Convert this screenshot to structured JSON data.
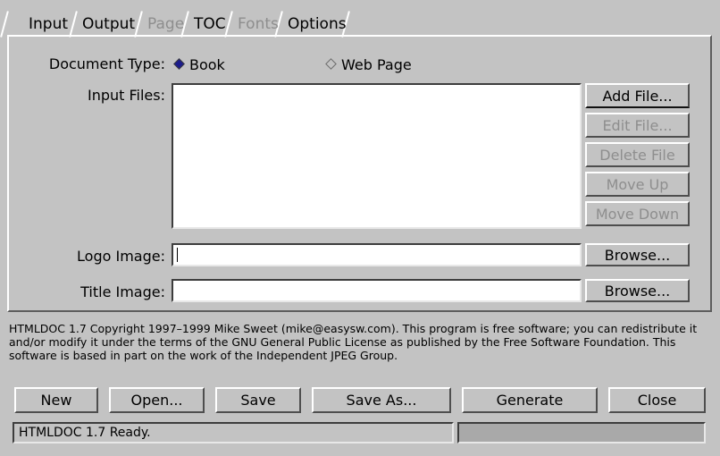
{
  "app": {
    "name": "HTMLDOC 1.7",
    "background_color": "#c3c3c3"
  },
  "tabs": [
    {
      "label": "Input",
      "enabled": true,
      "selected": true
    },
    {
      "label": "Output",
      "enabled": true,
      "selected": false
    },
    {
      "label": "Page",
      "enabled": false,
      "selected": false
    },
    {
      "label": "TOC",
      "enabled": true,
      "selected": false
    },
    {
      "label": "Fonts",
      "enabled": false,
      "selected": false
    },
    {
      "label": "Options",
      "enabled": true,
      "selected": false
    }
  ],
  "input_tab": {
    "document_type": {
      "label": "Document Type:",
      "selected": "Book",
      "options": [
        {
          "label": "Book",
          "checked": true
        },
        {
          "label": "Web Page",
          "checked": false
        }
      ]
    },
    "input_files": {
      "label": "Input Files:",
      "items": [],
      "buttons": [
        {
          "label": "Add File...",
          "enabled": true,
          "default": true
        },
        {
          "label": "Edit File...",
          "enabled": false,
          "default": false
        },
        {
          "label": "Delete File",
          "enabled": false,
          "default": false
        },
        {
          "label": "Move Up",
          "enabled": false,
          "default": false
        },
        {
          "label": "Move Down",
          "enabled": false,
          "default": false
        }
      ]
    },
    "logo_image": {
      "label": "Logo Image:",
      "value": "",
      "placeholder": "",
      "focused": true,
      "browse_label": "Browse..."
    },
    "title_image": {
      "label": "Title Image:",
      "value": "",
      "placeholder": "",
      "focused": false,
      "browse_label": "Browse..."
    }
  },
  "copyright": "HTMLDOC 1.7 Copyright 1997–1999 Mike Sweet (mike@easysw.com). This program is free software; you can redistribute it and/or modify it under the terms of the GNU General Public License as published by the Free Software Foundation. This software is based in part on the work of the Independent JPEG Group.",
  "action_buttons": [
    {
      "label": "New"
    },
    {
      "label": "Open..."
    },
    {
      "label": "Save"
    },
    {
      "label": "Save As..."
    },
    {
      "label": "Generate"
    },
    {
      "label": "Close"
    }
  ],
  "statusbar": {
    "message": "HTMLDOC 1.7 Ready.",
    "progress_percent": 0
  }
}
